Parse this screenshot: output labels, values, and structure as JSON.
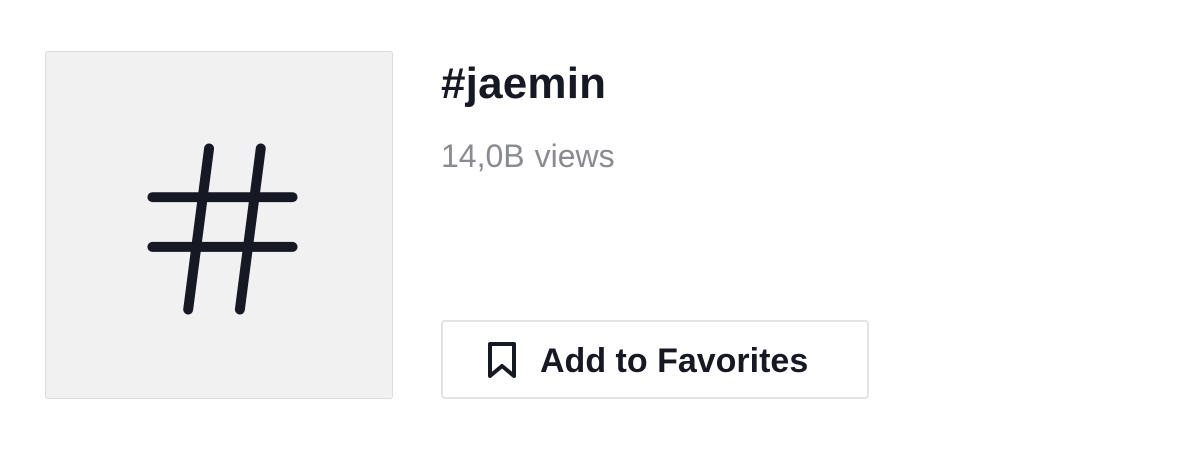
{
  "hashtag": {
    "title": "#jaemin",
    "views_count": "14,0B",
    "views_unit": "views",
    "cover_icon": "hashtag-icon"
  },
  "actions": {
    "favorite_label": "Add to Favorites",
    "favorite_icon": "bookmark-icon"
  },
  "colors": {
    "text_primary": "#161823",
    "text_secondary": "#8a8b91",
    "cover_bg": "#f1f1f2",
    "border": "#e3e3e4"
  }
}
